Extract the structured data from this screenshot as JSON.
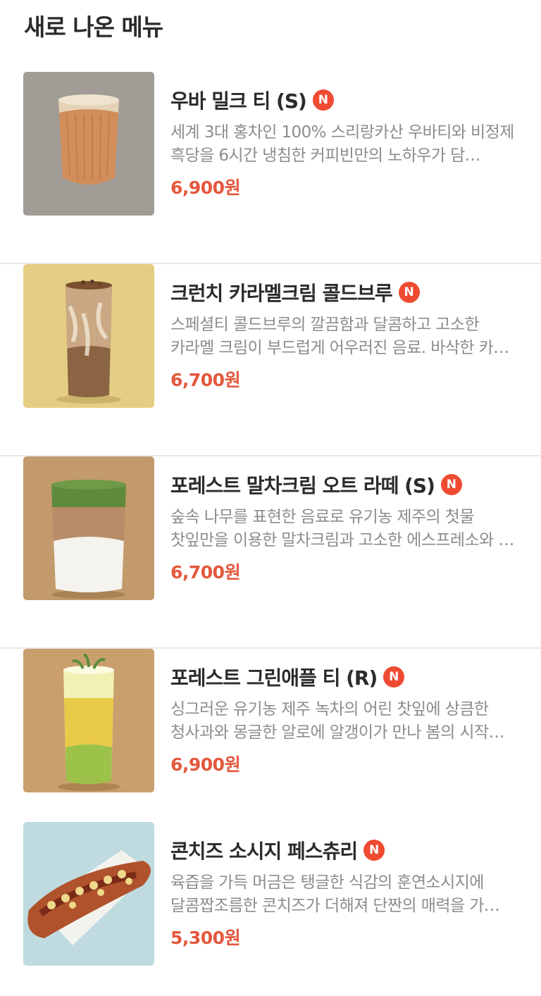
{
  "section": {
    "title": "새로 나온 메뉴"
  },
  "colors": {
    "accent": "#e4573d",
    "badge": "#ef4b32",
    "divider": "#e9e9e9",
    "description": "#8c8c8c"
  },
  "items": [
    {
      "name": "우바 밀크 티 (S)",
      "badge": "N",
      "description": "세계 3대 홍차인 100% 스리랑카산 우바티와 비정제 흑당을 6시간 냉침한 커피빈만의 노하우가 담…",
      "price": "6,900원",
      "image": "uva-milk-tea-photo"
    },
    {
      "name": "크런치 카라멜크림 콜드브루",
      "badge": "N",
      "description": "스페셜티 콜드브루의 깔끔함과 달콤하고 고소한 카라멜 크림이 부드럽게 어우러진 음료. 바삭한 카…",
      "price": "6,700원",
      "image": "crunch-caramel-cold-brew-photo"
    },
    {
      "name": "포레스트 말차크림 오트 라떼 (S)",
      "badge": "N",
      "description": "숲속 나무를 표현한 음료로 유기농 제주의 첫물 찻잎만을 이용한 말차크림과 고소한 에스프레소와 …",
      "price": "6,700원",
      "image": "forest-matcha-oat-latte-photo"
    },
    {
      "name": "포레스트 그린애플 티 (R)",
      "badge": "N",
      "description": "싱그러운 유기농 제주 녹차의 어린 찻잎에 상큼한 청사과와 몽글한 알로에 알갱이가 만나 봄의 시작…",
      "price": "6,900원",
      "image": "forest-green-apple-tea-photo"
    },
    {
      "name": "콘치즈 소시지 페스츄리",
      "badge": "N",
      "description": "육즙을 가득 머금은 탱글한 식감의 훈연소시지에 달콤짭조름한 콘치즈가 더해져 단짠의 매력을 가…",
      "price": "5,300원",
      "image": "corn-cheese-sausage-pastry-photo"
    }
  ]
}
